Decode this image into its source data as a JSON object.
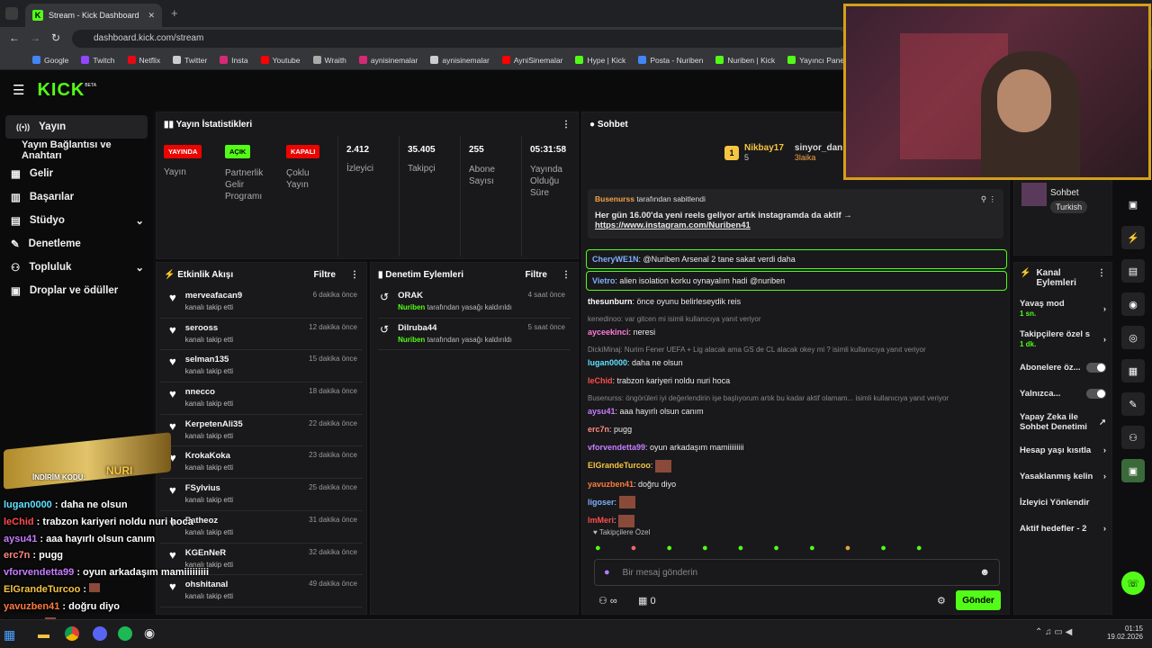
{
  "browser": {
    "tab_title": "Stream - Kick Dashboard",
    "url": "dashboard.kick.com/stream",
    "bookmarks": [
      {
        "label": "Google",
        "color": "#4285f4"
      },
      {
        "label": "Twitch",
        "color": "#9146ff"
      },
      {
        "label": "Netflix",
        "color": "#e50914"
      },
      {
        "label": "Twitter",
        "color": "#cccccc"
      },
      {
        "label": "Insta",
        "color": "#d62976"
      },
      {
        "label": "Youtube",
        "color": "#ff0000"
      },
      {
        "label": "Wraith",
        "color": "#aaaaaa"
      },
      {
        "label": "aynisinemalar",
        "color": "#d62976"
      },
      {
        "label": "aynisinemalar",
        "color": "#cccccc"
      },
      {
        "label": "AyniSinemalar",
        "color": "#ff0000"
      },
      {
        "label": "Hype | Kick",
        "color": "#53fc18"
      },
      {
        "label": "Posta - Nuriben",
        "color": "#4285f4"
      },
      {
        "label": "Nuriben | Kick",
        "color": "#53fc18"
      },
      {
        "label": "Yayıncı Paneli | Kick",
        "color": "#53fc18"
      }
    ]
  },
  "brand": {
    "logo": "KICK",
    "beta": "BETA",
    "accent": "#53fc18"
  },
  "sidebar": {
    "items": [
      {
        "label": "Yayın",
        "icon": "broadcast-icon"
      },
      {
        "label": "Yayın Bağlantısı ve Anahtarı"
      },
      {
        "label": "Gelir",
        "icon": "money-icon"
      },
      {
        "label": "Başarılar",
        "icon": "trophy-icon"
      },
      {
        "label": "Stüdyo",
        "icon": "studio-icon"
      },
      {
        "label": "Denetleme",
        "icon": "wrench-icon"
      },
      {
        "label": "Topluluk",
        "icon": "people-icon"
      },
      {
        "label": "Droplar ve ödüller",
        "icon": "gift-icon"
      }
    ]
  },
  "stats": {
    "title": "Yayın İstatistikleri",
    "badges": [
      {
        "pill": "YAYINDA",
        "label": "Yayın",
        "color": "#eb0400"
      },
      {
        "pill": "AÇIK",
        "label": "Partnerlik Gelir Programı",
        "color": "#53fc18"
      },
      {
        "pill": "KAPALI",
        "label": "Çoklu Yayın",
        "color": "#eb0400"
      }
    ],
    "numbers": [
      {
        "value": "2.412",
        "label": "İzleyici"
      },
      {
        "value": "35.405",
        "label": "Takipçi"
      },
      {
        "value": "255",
        "label": "Abone Sayısı"
      },
      {
        "value": "05:31:58",
        "label": "Yayında Olduğu Süre"
      }
    ]
  },
  "activity": {
    "title": "Etkinlik Akışı",
    "filter": "Filtre",
    "events": [
      {
        "name": "merveafacan9",
        "sub": "kanalı takip etti",
        "time": "6 dakika önce"
      },
      {
        "name": "serooss",
        "sub": "kanalı takip etti",
        "time": "12 dakika önce"
      },
      {
        "name": "selman135",
        "sub": "kanalı takip etti",
        "time": "15 dakika önce"
      },
      {
        "name": "nnecco",
        "sub": "kanalı takip etti",
        "time": "18 dakika önce"
      },
      {
        "name": "KerpetenAli35",
        "sub": "kanalı takip etti",
        "time": "22 dakika önce"
      },
      {
        "name": "KrokaKoka",
        "sub": "kanalı takip etti",
        "time": "23 dakika önce"
      },
      {
        "name": "FSylvius",
        "sub": "kanalı takip etti",
        "time": "25 dakika önce"
      },
      {
        "name": "Patheoz",
        "sub": "kanalı takip etti",
        "time": "31 dakika önce"
      },
      {
        "name": "KGEnNeR",
        "sub": "kanalı takip etti",
        "time": "32 dakika önce"
      },
      {
        "name": "ohshitanal",
        "sub": "kanalı takip etti",
        "time": "49 dakika önce"
      }
    ]
  },
  "moderation": {
    "title": "Denetim Eylemleri",
    "filter": "Filtre",
    "actions": [
      {
        "name": "ORAK",
        "by": "Nuriben",
        "text": "tarafından yasağı kaldırıldı",
        "time": "4 saat önce"
      },
      {
        "name": "Dilruba44",
        "by": "Nuriben",
        "text": "tarafından yasağı kaldırıldı",
        "time": "5 saat önce"
      }
    ]
  },
  "chat": {
    "title": "Sohbet",
    "leaders": [
      {
        "rank": "1",
        "name": "Nikbay17",
        "count": "5"
      },
      {
        "name": "sinyor_dan",
        "count": "3laika"
      }
    ],
    "pinned": {
      "by": "Busenurss",
      "label": "tarafından sabitlendi",
      "text": "Her gün 16.00'da yeni reels geliyor artık instagramda da aktif →",
      "link": "https://www.instagram.com/Nuriben41"
    },
    "messages": [
      {
        "user": "CheryWE1N",
        "color": "#7fb0ff",
        "text": "@Nuriben Arsenal 2 tane sakat verdi daha",
        "highlight": true
      },
      {
        "user": "Vietro",
        "color": "#7fb0ff",
        "text": "alien isolation korku oynayalım hadi @nuriben",
        "highlight": true
      },
      {
        "user": "thesunburn",
        "color": "#ffffff",
        "text": "önce oyunu belirleseydik reis"
      },
      {
        "reply": "kenedinoo: var gitcen mi isimli kullanıcıya yanıt veriyor",
        "user": "ayceekinci",
        "color": "#ff7ad9",
        "text": "neresi"
      },
      {
        "reply": "DickiMinaj: Nurim Fener UEFA + Lig alacak ama GS de CL alacak okey mi ? isimli kullanıcıya yanıt veriyor",
        "user": "lugan0000",
        "color": "#5fe3ff",
        "text": "daha ne olsun"
      },
      {
        "user": "leChid",
        "color": "#ff4d4d",
        "text": "trabzon kariyeri noldu nuri hoca"
      },
      {
        "reply": "Busenurss: öngörüleri iyi değerlendirin işe başlıyorum artık bu kadar aktif olamam... isimli kullanıcıya yanıt veriyor",
        "user": "aysu41",
        "color": "#c77dff",
        "text": "aaa hayırlı olsun canım"
      },
      {
        "user": "erc7n",
        "color": "#ff8a80",
        "text": "pugg"
      },
      {
        "user": "vforvendetta99",
        "color": "#c77dff",
        "text": "oyun arkadaşım mamiiiiiiiii"
      },
      {
        "user": "ElGrandeTurcoo",
        "color": "#f5c542",
        "text": ""
      },
      {
        "user": "yavuzben41",
        "color": "#ff7a3d",
        "text": "doğru diyo"
      },
      {
        "user": "ligoser",
        "color": "#7fb0ff",
        "text": ""
      },
      {
        "user": "lmMeri",
        "color": "#ff4d4d",
        "text": ""
      }
    ],
    "followers_only": "Takipçilere Özel",
    "placeholder": "Bir mesaj gönderin",
    "count": "0",
    "send": "Gönder"
  },
  "right": {
    "sohbet": "Sohbet",
    "lang": "Turkish",
    "title": "Kanal Eylemleri",
    "items": [
      {
        "label": "Yavaş mod",
        "sub": "1 sn."
      },
      {
        "label": "Takipçilere özel s",
        "sub": "1 dk."
      },
      {
        "label": "Abonelere öz..."
      },
      {
        "label": "Yalnızca..."
      },
      {
        "label": "Yapay Zeka ile Sohbet Denetimi"
      },
      {
        "label": "Hesap yaşı kısıtla"
      },
      {
        "label": "Yasaklanmış kelin"
      },
      {
        "label": "İzleyici Yönlendir"
      },
      {
        "label": "Aktif hedefler - 2"
      }
    ]
  },
  "overlay": {
    "brand": "NURI",
    "code": "İNDİRİM KODU:",
    "lines": [
      {
        "user": "lugan0000",
        "text": "daha ne olsun",
        "color": "#5fe3ff"
      },
      {
        "user": "leChid",
        "text": "trabzon kariyeri noldu nuri hoca",
        "color": "#ff4d4d"
      },
      {
        "user": "aysu41",
        "text": "aaa hayırlı olsun canım",
        "color": "#c77dff"
      },
      {
        "user": "erc7n",
        "text": "pugg",
        "color": "#ff8a80"
      },
      {
        "user": "vforvendetta99",
        "text": "oyun arkadaşım mamiiiiiiiii",
        "color": "#c77dff"
      },
      {
        "user": "ElGrandeTurcoo",
        "text": "",
        "color": "#f5c542"
      },
      {
        "user": "yavuzben41",
        "text": "doğru diyo",
        "color": "#ff7a3d"
      },
      {
        "user": "ligoser",
        "text": "",
        "color": "#7fb0ff"
      }
    ]
  },
  "taskbar": {
    "time": "01:15",
    "date": "19.02.2026"
  }
}
